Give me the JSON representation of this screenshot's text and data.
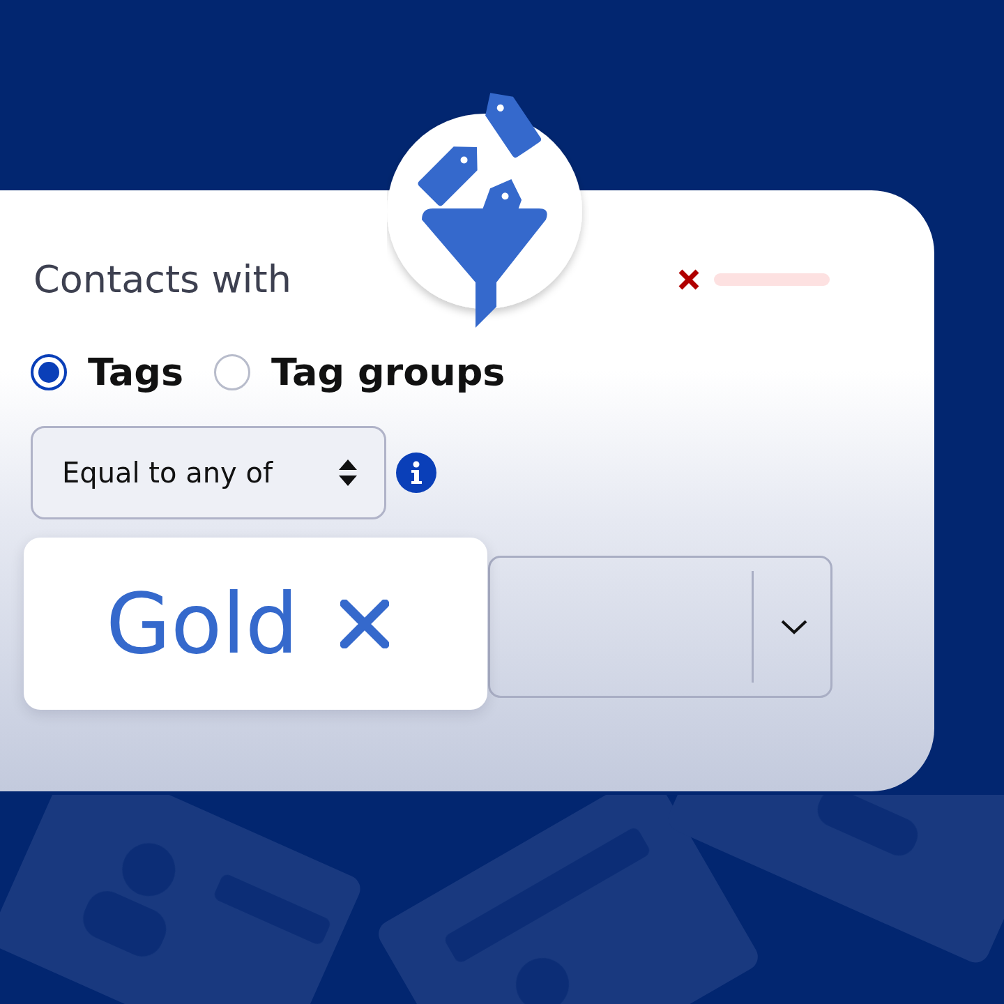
{
  "title": "Contacts with",
  "radios": [
    {
      "label": "Tags",
      "selected": true
    },
    {
      "label": "Tag groups",
      "selected": false
    }
  ],
  "condition": {
    "value": "Equal to any of"
  },
  "chips": [
    {
      "label": "Gold"
    }
  ]
}
